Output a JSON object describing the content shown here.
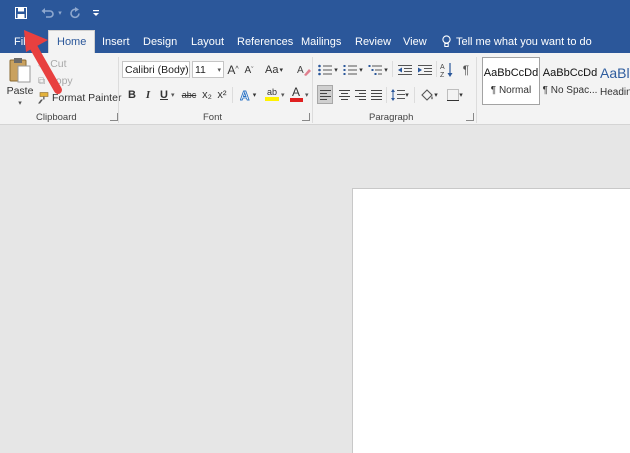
{
  "quick_access": {
    "save_icon": "save-icon",
    "undo_icon": "undo-icon",
    "redo_icon": "redo-icon",
    "customize_icon": "customize-icon"
  },
  "tabs": [
    {
      "label": "File"
    },
    {
      "label": "Home"
    },
    {
      "label": "Insert"
    },
    {
      "label": "Design"
    },
    {
      "label": "Layout"
    },
    {
      "label": "References"
    },
    {
      "label": "Mailings"
    },
    {
      "label": "Review"
    },
    {
      "label": "View"
    }
  ],
  "tell_me": "Tell me what you want to do",
  "clipboard": {
    "paste_label": "Paste",
    "cut_label": "Cut",
    "copy_label": "Copy",
    "format_painter_label": "Format Painter",
    "group_label": "Clipboard"
  },
  "font": {
    "font_name": "Calibri (Body)",
    "font_size": "11",
    "change_case": "Aa",
    "bold": "B",
    "italic": "I",
    "underline": "U",
    "strikethrough": "abc",
    "subscript": "x₂",
    "superscript": "x²",
    "grow": "A",
    "shrink": "A",
    "highlight": "ab",
    "font_color": "A",
    "group_label": "Font"
  },
  "paragraph": {
    "group_label": "Paragraph"
  },
  "styles": [
    {
      "preview": "AaBbCcDd",
      "name": "¶ Normal"
    },
    {
      "preview": "AaBbCcDd",
      "name": "¶ No Spac..."
    },
    {
      "preview": "AaBl",
      "name": "Headin"
    }
  ],
  "colors": {
    "brand": "#2b579a",
    "arrow": "#e8403f"
  }
}
